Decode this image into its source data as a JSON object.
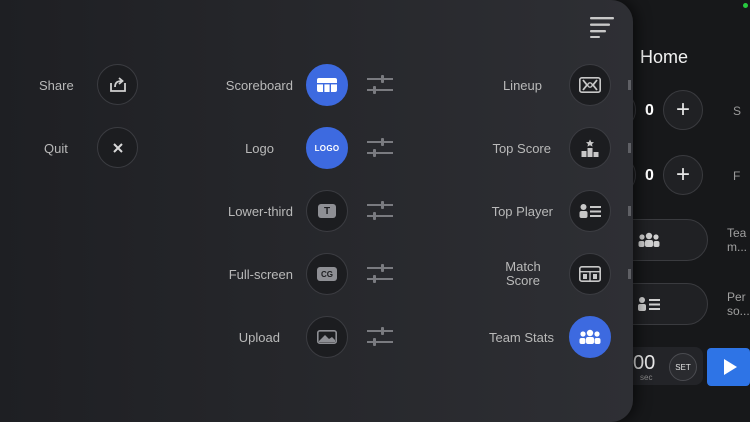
{
  "background_app": {
    "title": "Home",
    "score_rows": [
      {
        "value": "0",
        "plus_label": "+",
        "side_label": "S"
      },
      {
        "value": "0",
        "plus_label": "+",
        "side_label": "F"
      }
    ],
    "pills": [
      {
        "label_line1": "Tea",
        "label_line2": "m..."
      },
      {
        "label_line1": "Per",
        "label_line2": "so..."
      }
    ],
    "timer": {
      "value": "00",
      "unit": "sec",
      "set_label": "SET"
    },
    "colors": {
      "play": "#2e74e6",
      "status": "#27c93f"
    }
  },
  "overlay": {
    "menu_icon": "menu-lines-icon",
    "left_column": [
      {
        "label": "Share",
        "icon": "share-icon"
      },
      {
        "label": "Quit",
        "icon": "close-icon"
      }
    ],
    "middle_column": [
      {
        "label": "Scoreboard",
        "icon": "scoreboard-icon",
        "active": true
      },
      {
        "label": "Logo",
        "icon": "logo-icon",
        "icon_text": "LOGO",
        "active": true
      },
      {
        "label": "Lower-third",
        "icon": "text-t-icon",
        "icon_text": "T",
        "active": false
      },
      {
        "label": "Full-screen",
        "icon": "cg-icon",
        "icon_text": "CG",
        "active": false
      },
      {
        "label": "Upload",
        "icon": "image-icon",
        "active": false
      }
    ],
    "right_column": [
      {
        "label": "Lineup",
        "icon": "lineup-icon",
        "active": false
      },
      {
        "label": "Top Score",
        "icon": "podium-icon",
        "active": false
      },
      {
        "label": "Top Player",
        "icon": "player-list-icon",
        "active": false
      },
      {
        "label_line1": "Match",
        "label_line2": "Score",
        "icon": "match-score-icon",
        "active": false
      },
      {
        "label": "Team Stats",
        "icon": "team-icon",
        "active": true
      }
    ],
    "accent_color": "#3d6ae0"
  }
}
